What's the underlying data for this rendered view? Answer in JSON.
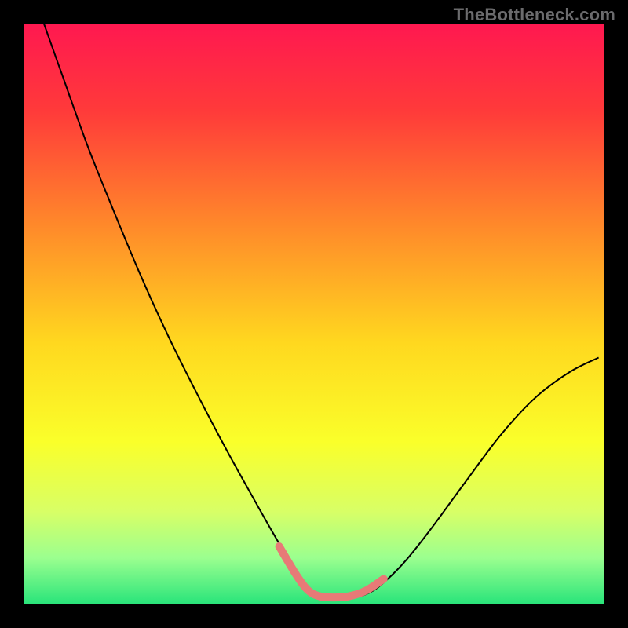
{
  "watermark": "TheBottleneck.com",
  "chart_data": {
    "type": "line",
    "title": "",
    "xlabel": "",
    "ylabel": "",
    "xlim": [
      0,
      1
    ],
    "ylim": [
      0,
      1
    ],
    "background_gradient": {
      "stops": [
        {
          "offset": 0.0,
          "color": "#ff1850"
        },
        {
          "offset": 0.15,
          "color": "#ff3a3a"
        },
        {
          "offset": 0.35,
          "color": "#ff8a2a"
        },
        {
          "offset": 0.55,
          "color": "#ffd81f"
        },
        {
          "offset": 0.72,
          "color": "#faff2a"
        },
        {
          "offset": 0.84,
          "color": "#d8ff66"
        },
        {
          "offset": 0.92,
          "color": "#9bff8f"
        },
        {
          "offset": 1.0,
          "color": "#28e47a"
        }
      ]
    },
    "series": [
      {
        "name": "bottleneck-curve",
        "color": "#000000",
        "width": 2.0,
        "x": [
          0.035,
          0.067,
          0.11,
          0.15,
          0.2,
          0.25,
          0.3,
          0.35,
          0.4,
          0.44,
          0.47,
          0.495,
          0.525,
          0.56,
          0.595,
          0.625,
          0.66,
          0.705,
          0.76,
          0.82,
          0.88,
          0.94,
          0.99
        ],
        "y": [
          1.0,
          0.91,
          0.79,
          0.69,
          0.57,
          0.46,
          0.36,
          0.265,
          0.175,
          0.105,
          0.058,
          0.024,
          0.01,
          0.01,
          0.02,
          0.042,
          0.078,
          0.135,
          0.21,
          0.29,
          0.355,
          0.4,
          0.425
        ]
      },
      {
        "name": "sweet-spot-marker",
        "color": "#e77a77",
        "width": 10,
        "linecap": "round",
        "x": [
          0.44,
          0.47,
          0.49,
          0.51,
          0.535,
          0.56,
          0.59,
          0.62
        ],
        "y": [
          0.1,
          0.05,
          0.024,
          0.014,
          0.012,
          0.014,
          0.024,
          0.044
        ]
      }
    ]
  }
}
